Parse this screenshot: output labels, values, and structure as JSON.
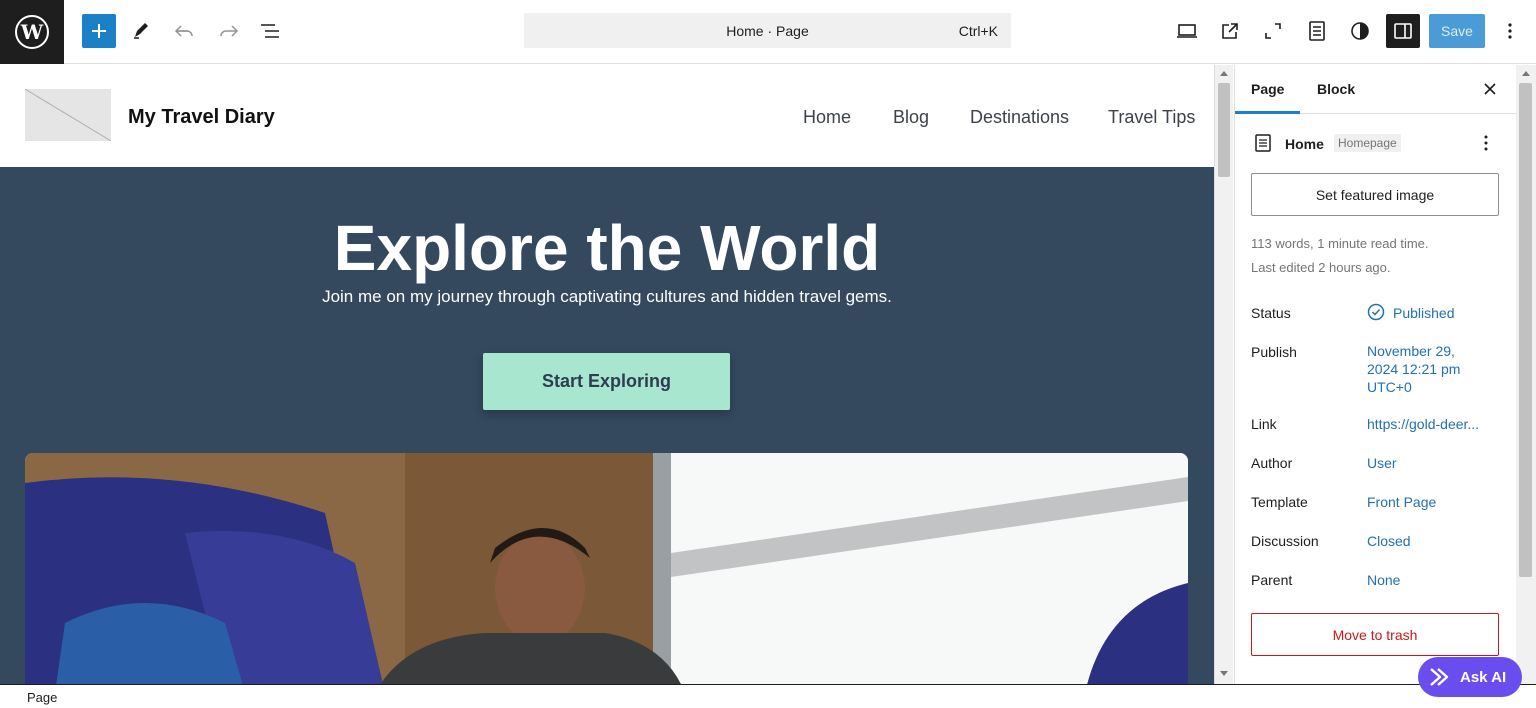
{
  "toolbar": {
    "document_title": "Home · Page",
    "shortcut": "Ctrl+K",
    "save_label": "Save"
  },
  "site": {
    "title": "My Travel Diary",
    "nav": [
      "Home",
      "Blog",
      "Destinations",
      "Travel Tips"
    ]
  },
  "hero": {
    "title": "Explore the World",
    "subtitle": "Join me on my journey through captivating cultures and hidden travel gems.",
    "cta_label": "Start Exploring"
  },
  "sidebar": {
    "tabs": [
      "Page",
      "Block"
    ],
    "page_name": "Home",
    "page_badge": "Homepage",
    "featured_image_label": "Set featured image",
    "word_info": "113 words, 1 minute read time.",
    "last_edited": "Last edited 2 hours ago.",
    "status": {
      "label": "Status",
      "value": "Published"
    },
    "publish": {
      "label": "Publish",
      "value_line1": "November 29,",
      "value_line2": "2024 12:21 pm",
      "value_line3": "UTC+0"
    },
    "link": {
      "label": "Link",
      "value": "https://gold-deer..."
    },
    "author": {
      "label": "Author",
      "value": "User"
    },
    "template": {
      "label": "Template",
      "value": "Front Page"
    },
    "discussion": {
      "label": "Discussion",
      "value": "Closed"
    },
    "parent": {
      "label": "Parent",
      "value": "None"
    },
    "trash_label": "Move to trash"
  },
  "footer": {
    "breadcrumb": "Page"
  },
  "ask_ai": {
    "label": "Ask AI"
  },
  "colors": {
    "accent": "#1b80c5",
    "hero_bg": "#34495e",
    "cta_bg": "#a8e6cf",
    "danger": "#cc1818",
    "ask_ai": "#6a4dee"
  }
}
